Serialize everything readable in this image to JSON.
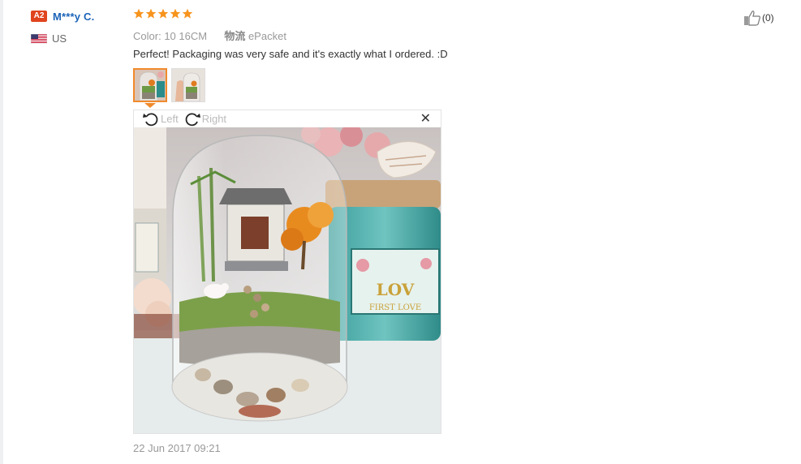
{
  "buyer": {
    "level": "A2",
    "name": "M***y C.",
    "flag_icon": "us-flag-icon",
    "country": "US"
  },
  "review": {
    "rating": 5,
    "rating_max": 5,
    "star_icon": "star-icon",
    "star_color": "#f7941d",
    "color_label": "Color:",
    "color_value": "10 16CM",
    "shipping_label": "物流",
    "shipping_value": "ePacket",
    "comment": "Perfect! Packaging was very safe and it's exactly what I ordered. :D",
    "date": "22 Jun 2017 09:21"
  },
  "photos": {
    "thumbnails": [
      "terrarium-photo-1",
      "terrarium-photo-2"
    ],
    "active_index": 0
  },
  "viewer": {
    "rotate_left_label": "Left",
    "rotate_right_label": "Right",
    "close_icon": "close-icon",
    "photo_label": "LOV",
    "photo_sublabel": "FIRST LOVE"
  },
  "helpful": {
    "icon": "thumbs-up-icon",
    "count": "(0)"
  },
  "colors": {
    "badge": "#e0441e",
    "name_link": "#1b63b8",
    "active_thumb": "#f08a2c"
  }
}
